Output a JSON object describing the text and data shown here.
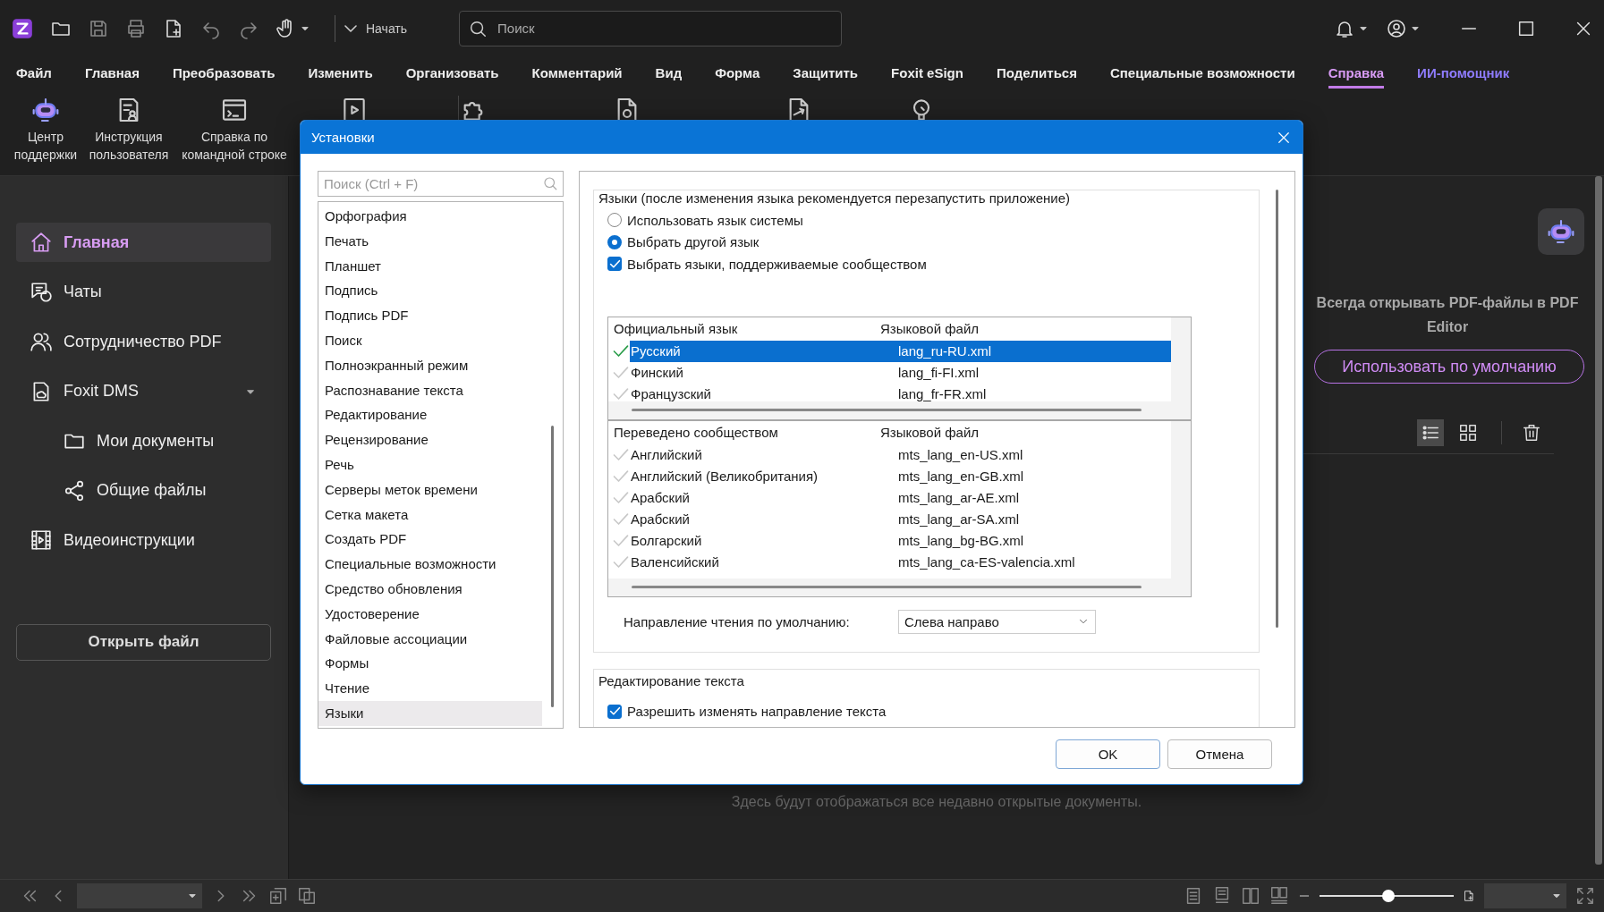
{
  "toolbar": {
    "start_label": "Начать",
    "search": {
      "placeholder": "Поиск"
    }
  },
  "menu": [
    {
      "label": "Файл",
      "selected": false,
      "kind": "menu"
    },
    {
      "label": "Главная",
      "selected": false,
      "kind": "menu"
    },
    {
      "label": "Преобразовать",
      "selected": false,
      "kind": "menu"
    },
    {
      "label": "Изменить",
      "selected": false,
      "kind": "menu"
    },
    {
      "label": "Организовать",
      "selected": false,
      "kind": "menu"
    },
    {
      "label": "Комментарий",
      "selected": false,
      "kind": "menu"
    },
    {
      "label": "Вид",
      "selected": false,
      "kind": "menu"
    },
    {
      "label": "Форма",
      "selected": false,
      "kind": "menu"
    },
    {
      "label": "Защитить",
      "selected": false,
      "kind": "menu"
    },
    {
      "label": "Foxit eSign",
      "selected": false,
      "kind": "menu"
    },
    {
      "label": "Поделиться",
      "selected": false,
      "kind": "menu"
    },
    {
      "label": "Специальные возможности",
      "selected": false,
      "kind": "menu"
    },
    {
      "label": "Справка",
      "selected": true,
      "kind": "menu"
    },
    {
      "label": "ИИ-помощник",
      "selected": false,
      "kind": "ai"
    }
  ],
  "ribbon": [
    {
      "label": "Центр поддержки"
    },
    {
      "label": "Инструкция пользователя"
    },
    {
      "label": "Справка по командной строке"
    }
  ],
  "sidebar": {
    "items": [
      {
        "label": "Главная",
        "selected": true
      },
      {
        "label": "Чаты",
        "selected": false
      },
      {
        "label": "Сотрудничество PDF",
        "selected": false
      },
      {
        "label": "Foxit DMS",
        "selected": false,
        "expanded": true,
        "children": [
          {
            "label": "Мои документы",
            "selected": false
          },
          {
            "label": "Общие файлы",
            "selected": false
          }
        ]
      },
      {
        "label": "Видеоинструкции",
        "selected": false
      }
    ],
    "open_button": "Открыть файл"
  },
  "home": {
    "default_prompt": "Всегда открывать PDF-файлы в PDF Editor",
    "default_button": "Использовать по умолчанию",
    "view": [
      {
        "kind": "list",
        "selected": true
      },
      {
        "kind": "grid",
        "selected": false
      }
    ],
    "empty_text": "Здесь будут отображаться все недавно открытые документы."
  },
  "dialog": {
    "title": "Установки",
    "search": {
      "placeholder": "Поиск (Ctrl + F)"
    },
    "categories": [
      {
        "label": "Орфография",
        "selected": false
      },
      {
        "label": "Печать",
        "selected": false
      },
      {
        "label": "Планшет",
        "selected": false
      },
      {
        "label": "Подпись",
        "selected": false
      },
      {
        "label": "Подпись PDF",
        "selected": false
      },
      {
        "label": "Поиск",
        "selected": false
      },
      {
        "label": "Полноэкранный режим",
        "selected": false
      },
      {
        "label": "Распознавание текста",
        "selected": false
      },
      {
        "label": "Редактирование",
        "selected": false
      },
      {
        "label": "Рецензирование",
        "selected": false
      },
      {
        "label": "Речь",
        "selected": false
      },
      {
        "label": "Серверы меток времени",
        "selected": false
      },
      {
        "label": "Сетка макета",
        "selected": false
      },
      {
        "label": "Создать PDF",
        "selected": false
      },
      {
        "label": "Специальные возможности",
        "selected": false
      },
      {
        "label": "Средство обновления",
        "selected": false
      },
      {
        "label": "Удостоверение",
        "selected": false
      },
      {
        "label": "Файловые ассоциации",
        "selected": false
      },
      {
        "label": "Формы",
        "selected": false
      },
      {
        "label": "Чтение",
        "selected": false
      },
      {
        "label": "Языки",
        "selected": true
      }
    ],
    "languages": {
      "title": "Языки (после изменения языка рекомендуется перезапустить приложение)",
      "options": [
        {
          "kind": "radio",
          "label": "Использовать язык системы",
          "selected": false
        },
        {
          "kind": "radio",
          "label": "Выбрать другой язык",
          "selected": true
        },
        {
          "kind": "checkbox",
          "label": "Выбрать языки, поддерживаемые сообществом",
          "checked": true
        }
      ],
      "tables": [
        {
          "columns": [
            "Официальный язык",
            "Языковой файл"
          ],
          "rows": [
            {
              "name": "Русский",
              "file": "lang_ru-RU.xml",
              "selected": true,
              "active": true
            },
            {
              "name": "Финский",
              "file": "lang_fi-FI.xml",
              "selected": false,
              "active": false
            },
            {
              "name": "Французский",
              "file": "lang_fr-FR.xml",
              "selected": false,
              "active": false
            }
          ]
        },
        {
          "columns": [
            "Переведено сообществом",
            "Языковой файл"
          ],
          "rows": [
            {
              "name": "Английский",
              "file": "mts_lang_en-US.xml",
              "selected": false,
              "active": false
            },
            {
              "name": "Английский (Великобритания)",
              "file": "mts_lang_en-GB.xml",
              "selected": false,
              "active": false
            },
            {
              "name": "Арабский",
              "file": "mts_lang_ar-AE.xml",
              "selected": false,
              "active": false
            },
            {
              "name": "Арабский",
              "file": "mts_lang_ar-SA.xml",
              "selected": false,
              "active": false
            },
            {
              "name": "Болгарский",
              "file": "mts_lang_bg-BG.xml",
              "selected": false,
              "active": false
            },
            {
              "name": "Валенсийский",
              "file": "mts_lang_ca-ES-valencia.xml",
              "selected": false,
              "active": false
            }
          ]
        }
      ],
      "direction": {
        "label": "Направление чтения по умолчанию:",
        "value": "Слева направо"
      }
    },
    "text_editing": {
      "title": "Редактирование текста",
      "options": [
        {
          "kind": "checkbox",
          "label": "Разрешить изменять направление текста",
          "checked": true
        }
      ]
    },
    "buttons": [
      "OK",
      "Отмена"
    ]
  },
  "status_bar": {
    "zoom": {
      "level": 0.51
    }
  }
}
